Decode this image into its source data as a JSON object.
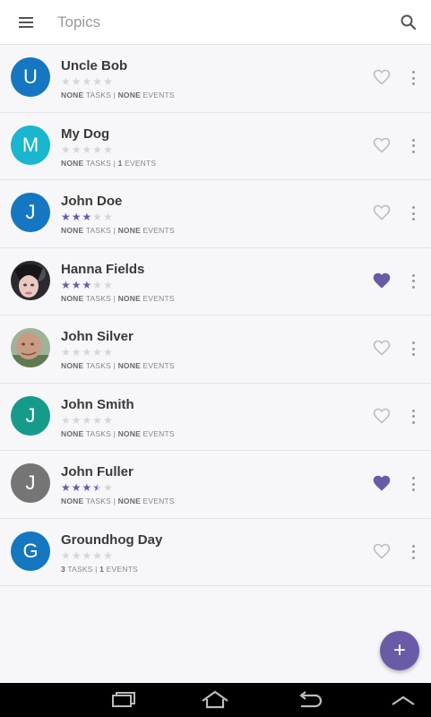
{
  "header": {
    "title": "Topics",
    "menu_icon": "menu-icon",
    "search_icon": "search-icon"
  },
  "colors": {
    "accent": "#6b5ba6",
    "star_on": "#6b5ba6",
    "star_off": "#d6d6d6",
    "heart_on": "#6b5ba6",
    "heart_off": "#bdbdbd"
  },
  "topics": [
    {
      "name": "Uncle Bob",
      "initial": "U",
      "avatar_color": "#1577c1",
      "rating": 0,
      "tasks": "NONE",
      "events": "NONE",
      "favorite": false
    },
    {
      "name": "My Dog",
      "initial": "M",
      "avatar_color": "#1ab5cf",
      "rating": 0,
      "tasks": "NONE",
      "events": "1",
      "favorite": false
    },
    {
      "name": "John Doe",
      "initial": "J",
      "avatar_color": "#1577c1",
      "rating": 3,
      "tasks": "NONE",
      "events": "NONE",
      "favorite": false
    },
    {
      "name": "Hanna Fields",
      "initial": "",
      "avatar_color": "",
      "avatar_photo": "photo-woman",
      "rating": 3,
      "tasks": "NONE",
      "events": "NONE",
      "favorite": true
    },
    {
      "name": "John Silver",
      "initial": "",
      "avatar_color": "",
      "avatar_photo": "photo-man",
      "rating": 0,
      "tasks": "NONE",
      "events": "NONE",
      "favorite": false
    },
    {
      "name": "John Smith",
      "initial": "J",
      "avatar_color": "#169b8a",
      "rating": 0,
      "tasks": "NONE",
      "events": "NONE",
      "favorite": false
    },
    {
      "name": "John Fuller",
      "initial": "J",
      "avatar_color": "#757575",
      "rating": 3.5,
      "tasks": "NONE",
      "events": "NONE",
      "favorite": true
    },
    {
      "name": "Groundhog Day",
      "initial": "G",
      "avatar_color": "#1577c1",
      "rating": 0,
      "tasks": "3",
      "events": "1",
      "favorite": false
    }
  ],
  "labels": {
    "tasks": "TASKS",
    "events": "EVENTS",
    "separator": "|"
  },
  "fab": {
    "label": "+"
  },
  "navbar": {
    "icons": [
      "recent-apps-icon",
      "home-icon",
      "back-icon",
      "menu-up-icon"
    ]
  }
}
